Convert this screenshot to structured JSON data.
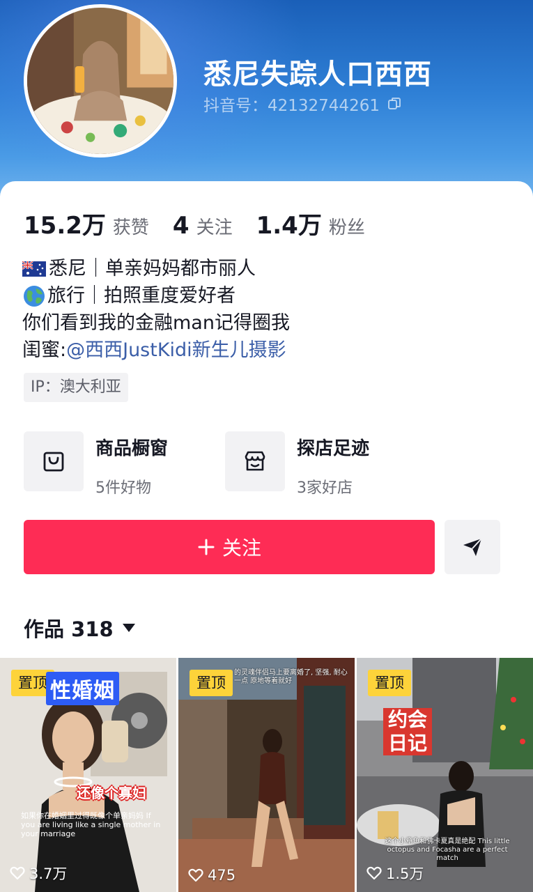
{
  "profile": {
    "username": "悉尼失踪人口西西",
    "douyin_id": "抖音号：42132744261"
  },
  "stats": [
    {
      "value": "15.2万",
      "label": "获赞"
    },
    {
      "value": "4",
      "label": "关注"
    },
    {
      "value": "1.4万",
      "label": "粉丝"
    }
  ],
  "bio": {
    "line1": "悉尼｜单亲妈妈都市丽人",
    "line2": "旅行｜拍照重度爱好者",
    "line3": "你们看到我的金融man记得圈我",
    "line4_prefix": "闺蜜: ",
    "line4_mention": "@西西JustKidi新生儿摄影"
  },
  "ip": "IP：澳大利亚",
  "features": [
    {
      "title": "商品橱窗",
      "sub": "5件好物",
      "icon": "shopping-bag-icon"
    },
    {
      "title": "探店足迹",
      "sub": "3家好店",
      "icon": "storefront-icon"
    }
  ],
  "actions": {
    "follow_label": "关注",
    "share_icon": "send-icon"
  },
  "works_tab": {
    "label": "作品 318"
  },
  "videos": [
    {
      "pin": "置顶",
      "likes": "3.7万",
      "title": "性婚姻",
      "caption": "还像个寡妇",
      "subtitle": "如果你在婚姻里过得既像个单亲妈妈 If you are living like a single mother in your marriage"
    },
    {
      "pin": "置顶",
      "likes": "475",
      "subtitle": "的灵魂伴侣马上要离婚了, 坚强, 耐心一点 原地等着就好"
    },
    {
      "pin": "置顶",
      "likes": "1.5万",
      "title": "约会日记",
      "subtitle": "这个小章鱼和佛卡夏真是绝配 This little octopus and Focasha are a perfect match"
    }
  ],
  "colors": {
    "accent": "#fe2c55",
    "header_top": "#1a5fb8",
    "mention": "#3b5ea8",
    "pin": "#fdd33a"
  }
}
